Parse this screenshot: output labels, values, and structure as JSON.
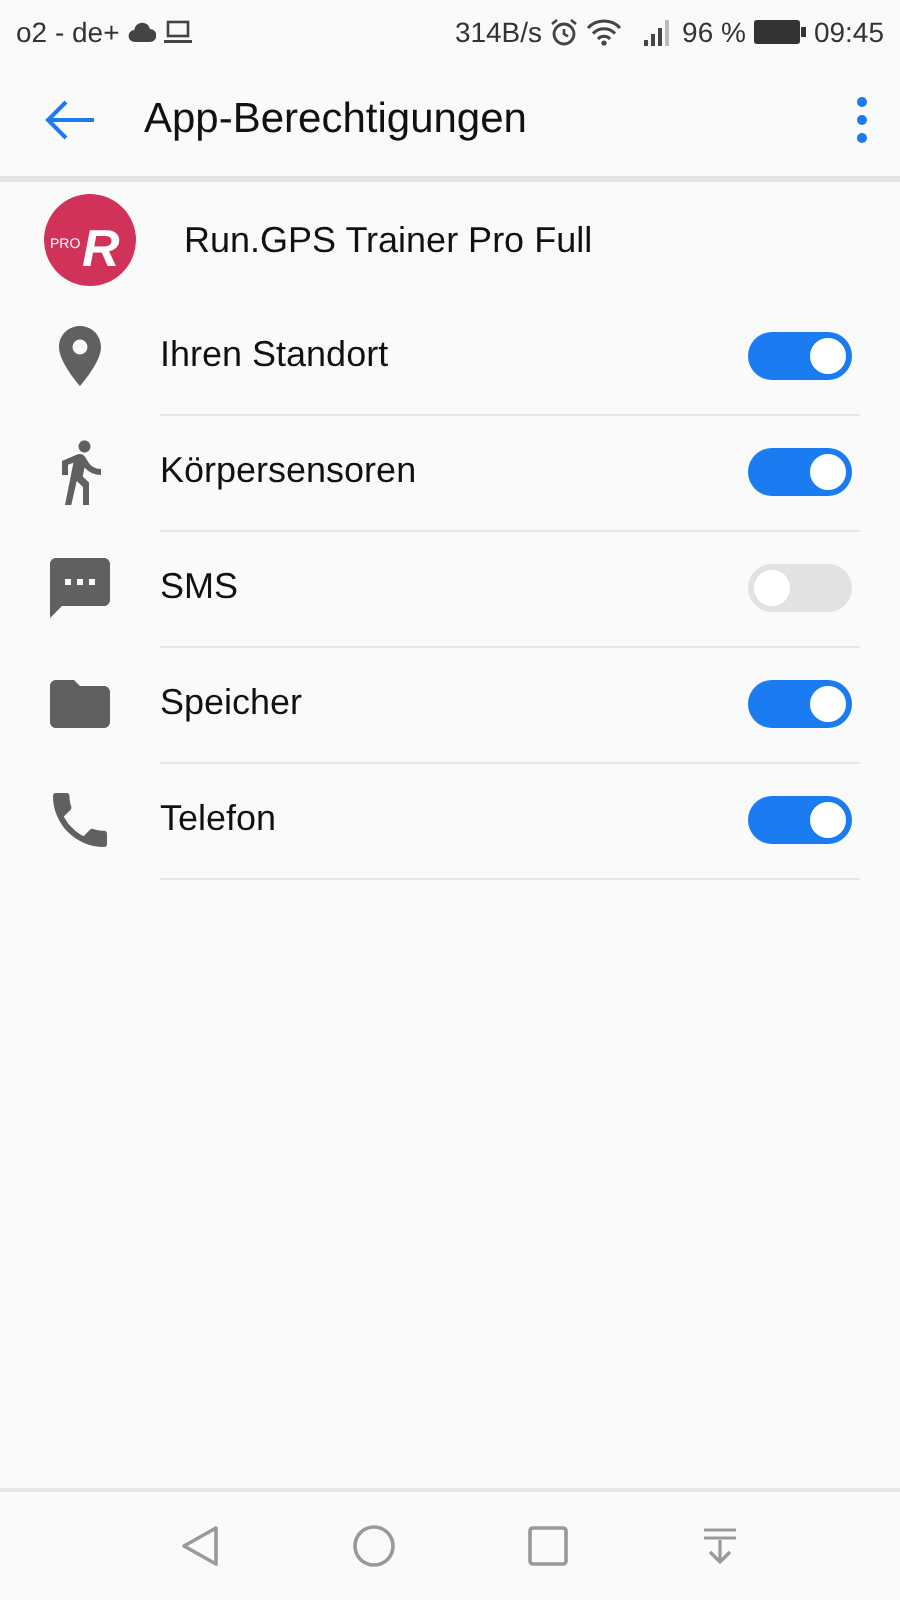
{
  "status_bar": {
    "carrier": "o2 - de+",
    "speed": "314B/s",
    "battery": "96 %",
    "time": "09:45"
  },
  "toolbar": {
    "title": "App-Berechtigungen"
  },
  "app": {
    "name": "Run.GPS Trainer Pro Full",
    "logo_badge": "PRO",
    "logo_letter": "R"
  },
  "permissions": [
    {
      "kind": "location",
      "label": "Ihren Standort",
      "on": true
    },
    {
      "kind": "activity",
      "label": "Körpersensoren",
      "on": true
    },
    {
      "kind": "sms",
      "label": "SMS",
      "on": false
    },
    {
      "kind": "storage",
      "label": "Speicher",
      "on": true
    },
    {
      "kind": "phone",
      "label": "Telefon",
      "on": true
    }
  ]
}
